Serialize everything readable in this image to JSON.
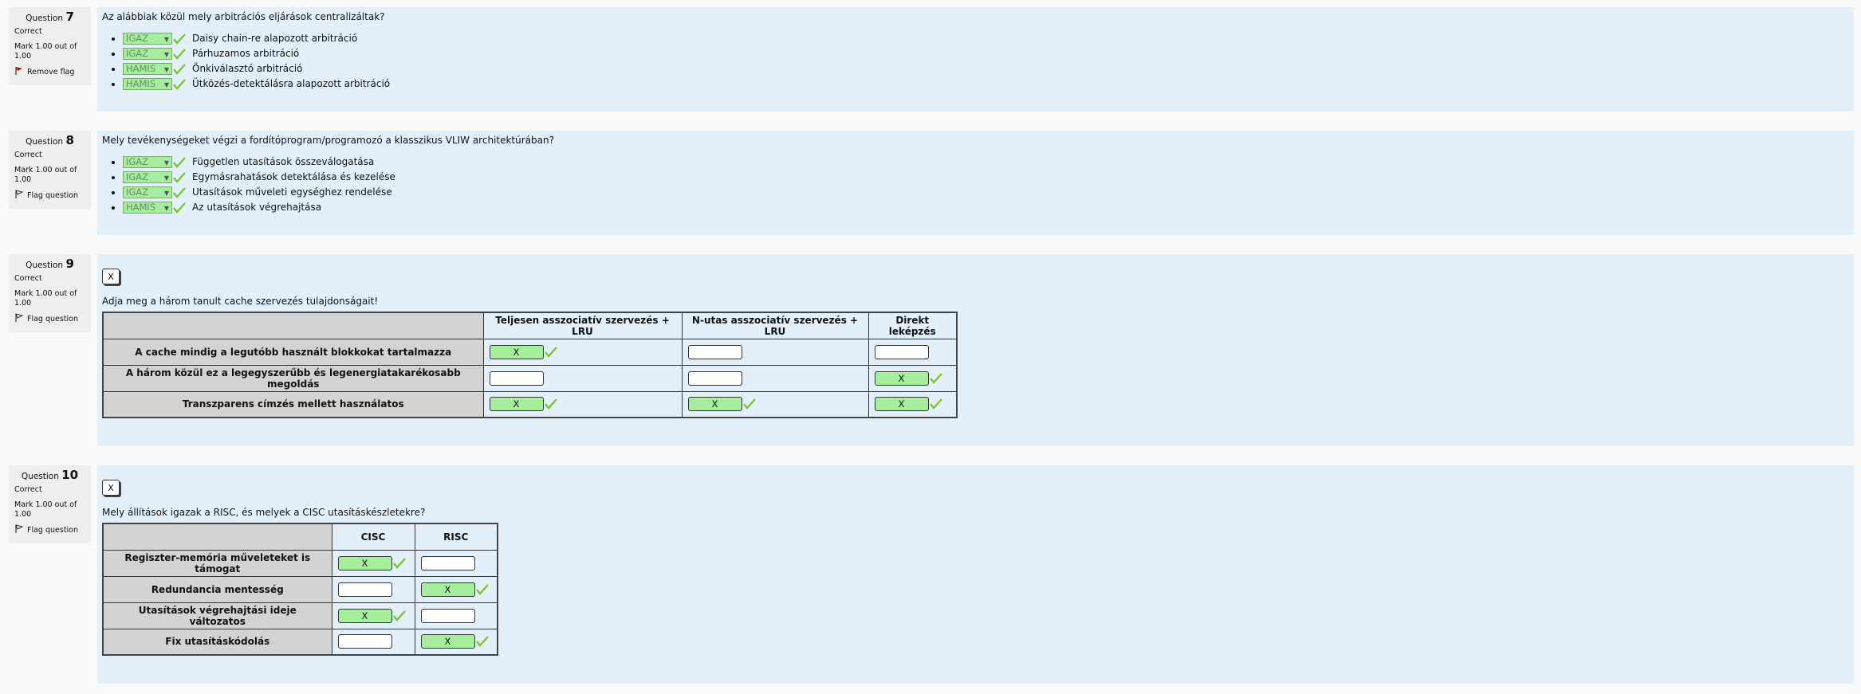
{
  "questions": [
    {
      "label": "Question",
      "number": "7",
      "state": "Correct",
      "mark": "Mark 1.00 out of 1.00",
      "flag": "Remove flag",
      "text": "Az alábbiak közül mely arbitrációs eljárások centralizáltak?",
      "items": [
        {
          "value": "IGAZ",
          "label": "Daisy chain-re alapozott arbitráció"
        },
        {
          "value": "IGAZ",
          "label": "Párhuzamos arbitráció"
        },
        {
          "value": "HAMIS",
          "label": "Önkiválasztó arbitráció"
        },
        {
          "value": "HAMIS",
          "label": "Ütközés-detektálásra alapozott arbitráció"
        }
      ]
    },
    {
      "label": "Question",
      "number": "8",
      "state": "Correct",
      "mark": "Mark 1.00 out of 1.00",
      "flag": "Flag question",
      "text": "Mely tevékenységeket végzi a fordítóprogram/programozó a klasszikus VLIW architektúrában?",
      "items": [
        {
          "value": "IGAZ",
          "label": "Független utasítások összeválogatása"
        },
        {
          "value": "IGAZ",
          "label": "Egymásrahatások detektálása és kezelése"
        },
        {
          "value": "IGAZ",
          "label": "Utasítások műveleti egységhez rendelése"
        },
        {
          "value": "HAMIS",
          "label": "Az utasítások végrehajtása"
        }
      ]
    },
    {
      "label": "Question",
      "number": "9",
      "state": "Correct",
      "mark": "Mark 1.00 out of 1.00",
      "flag": "Flag question",
      "xbutton": "X",
      "text": "Adja meg a három tanult cache szervezés tulajdonságait!",
      "columns": [
        "Teljesen asszociatív szervezés + LRU",
        "N-utas asszociatív szervezés + LRU",
        "Direkt leképzés"
      ],
      "rows": [
        {
          "label": "A cache mindig a legutóbb használt blokkokat tartalmazza",
          "cells": [
            "X",
            "",
            ""
          ]
        },
        {
          "label": "A három közül ez a legegyszerűbb és legenergiatakarékosabb megoldás",
          "cells": [
            "",
            "",
            "X"
          ]
        },
        {
          "label": "Transzparens címzés mellett használatos",
          "cells": [
            "X",
            "X",
            "X"
          ]
        }
      ]
    },
    {
      "label": "Question",
      "number": "10",
      "state": "Correct",
      "mark": "Mark 1.00 out of 1.00",
      "flag": "Flag question",
      "xbutton": "X",
      "text": "Mely állítások igazak a RISC, és melyek a CISC utasításkészletekre?",
      "columns": [
        "CISC",
        "RISC"
      ],
      "rows": [
        {
          "label": "Regiszter-memória műveleteket is támogat",
          "cells": [
            "X",
            ""
          ]
        },
        {
          "label": "Redundancia mentesség",
          "cells": [
            "",
            "X"
          ]
        },
        {
          "label": "Utasítások végrehajtási ideje változatos",
          "cells": [
            "X",
            ""
          ]
        },
        {
          "label": "Fix utasításkódolás",
          "cells": [
            "",
            "X"
          ]
        }
      ]
    }
  ],
  "colors": {
    "correct_bg": "#a6ee9e",
    "panel_bg": "#e3f0fa",
    "info_bg": "#eeeeee",
    "check": "#7cc52b",
    "flag_red": "#cc0000"
  }
}
